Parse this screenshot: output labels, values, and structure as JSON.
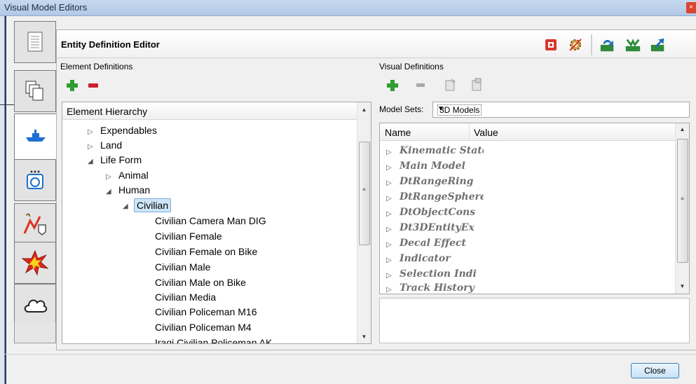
{
  "window": {
    "title": "Visual Model Editors",
    "close_glyph": "×"
  },
  "sidebar": {
    "tabs": [
      {
        "icon": "document-icon"
      },
      {
        "icon": "copy-pages-icon"
      },
      {
        "icon": "ship-icon",
        "selected": true
      },
      {
        "icon": "sensor-icon"
      },
      {
        "icon": "path-icon"
      },
      {
        "icon": "explosion-icon"
      },
      {
        "icon": "cloud-icon"
      }
    ]
  },
  "editor": {
    "title": "Entity Definition Editor",
    "element_definitions_label": "Element Definitions",
    "visual_definitions_label": "Visual Definitions",
    "tree": {
      "header": "Element Hierarchy",
      "nodes": [
        {
          "label": "Expendables",
          "arrow": "▷"
        },
        {
          "label": "Land",
          "arrow": "▷"
        },
        {
          "label": "Life Form",
          "arrow": "◢"
        },
        {
          "label": "Animal",
          "arrow": "▷"
        },
        {
          "label": "Human",
          "arrow": "◢"
        },
        {
          "label": "Civilian",
          "arrow": "◢"
        },
        {
          "label": "Civilian Camera Man DIG"
        },
        {
          "label": "Civilian Female"
        },
        {
          "label": "Civilian Female on Bike"
        },
        {
          "label": "Civilian Male"
        },
        {
          "label": "Civilian Male on Bike"
        },
        {
          "label": "Civilian Media"
        },
        {
          "label": "Civilian Policeman M16"
        },
        {
          "label": "Civilian Policeman M4"
        },
        {
          "label": "Iraqi Civilian Policeman AK"
        }
      ]
    },
    "model_sets": {
      "label": "Model Sets:",
      "value": "3D Models"
    },
    "grid": {
      "columns": [
        "Name",
        "Value"
      ],
      "items": [
        "Kinematic State",
        "Main Model",
        "DtRangeRing",
        "DtRangeSphere",
        "DtObjectCons",
        "Dt3DEntityEx",
        "Decal Effect",
        "Indicator",
        "Selection Indi",
        "Track History"
      ]
    }
  },
  "footer": {
    "close_label": "Close"
  },
  "colors": {
    "plus": "#2e9e2e",
    "minus": "#cc1f2e",
    "selection": "#cde6f7"
  }
}
